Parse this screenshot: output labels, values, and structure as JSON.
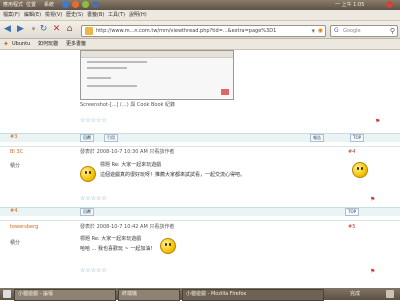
{
  "panel": {
    "applications": "應用程式",
    "places": "位置",
    "system": "系統",
    "clock": "一  上午 1:05"
  },
  "menubar": {
    "items": [
      "檔案(F)",
      "編輯(E)",
      "檢視(V)",
      "歷史(S)",
      "書籤(B)",
      "工具(T)",
      "說明(H)"
    ]
  },
  "nav": {
    "url": "http://www.m...n.com.tw/mm/viewthread.php?tid=...&extra=page%3D1",
    "search_placeholder": "Google"
  },
  "bookmarks": {
    "items": [
      "Ubuntu",
      "如何玩貓",
      "更多書籤"
    ]
  },
  "thread": {
    "screenshot_caption": "Screenshot-[...] (...) 與 Cook Book 紀錄",
    "post1": {
      "floor": "#3",
      "reply_label": "回覆",
      "quote_label": "引用",
      "report_label": "報告",
      "top_label": "TOP"
    },
    "post2": {
      "author": "Bl 3C",
      "meta": "發表於 2008-10-7 10:30 AM  只看該作者",
      "floor": "#4",
      "title": "標題  Re: 大家一起來玩遊戲",
      "body": "這個遊戲真的很好玩呀！推薦大家都來試試看，一起交流心得吧。",
      "reply_label": "回覆",
      "top_label": "TOP"
    },
    "post3": {
      "author": "towersberg",
      "meta": "發表於 2008-10-7 10:42 AM  只看該作者",
      "floor": "#5",
      "title": "標題  Re: 大家一起來玩遊戲",
      "body": "哈哈 ... 我也喜歡玩 ~ 一起加油！",
      "reply_label": "回覆",
      "top_label": "TOP"
    }
  },
  "taskbar": {
    "items": [
      "小貓遊戲 - 論壇",
      "終端機",
      "小貓遊戲 - Mozilla Firefox"
    ],
    "status": "完成"
  }
}
